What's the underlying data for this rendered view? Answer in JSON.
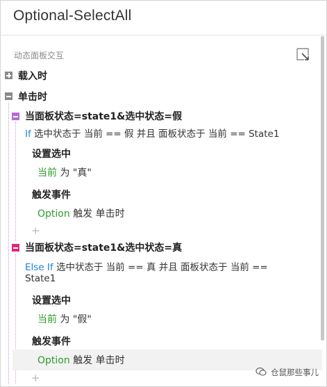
{
  "panel": {
    "title": "Optional-SelectAll",
    "section_label": "动态面板交互",
    "corner_icon": "expand-corner-icon"
  },
  "tree": {
    "onload_label": "载入时",
    "onclick_label": "单击时",
    "case1": {
      "title": "当面板状态=state1&选中状态=假",
      "keyword": "If",
      "condition": "选中状态于 当前 == 假 并且 面板状态于 当前 == State1",
      "action1_title": "设置选中",
      "action1_target": "当前",
      "action1_rest": "为 \"真\"",
      "action2_title": "触发事件",
      "action2_target": "Option",
      "action2_rest": "触发 单击时",
      "add": "+"
    },
    "case2": {
      "title": "当面板状态=state1&选中状态=真",
      "keyword": "Else If",
      "condition_line1": "选中状态于 当前 == 真 并且 面板状态于 当前 ==",
      "condition_line2": "State1",
      "action1_title": "设置选中",
      "action1_target": "当前",
      "action1_rest": "为 \"假\"",
      "action2_title": "触发事件",
      "action2_target": "Option",
      "action2_rest": "触发 单击时",
      "add": "+"
    }
  },
  "watermark": {
    "text": "仓鼠那些事儿"
  },
  "colors": {
    "keyword_blue": "#1e84d8",
    "target_green": "#2d9b2d",
    "case1_purple": "#b46cd6",
    "case2_pink": "#e0287a"
  }
}
